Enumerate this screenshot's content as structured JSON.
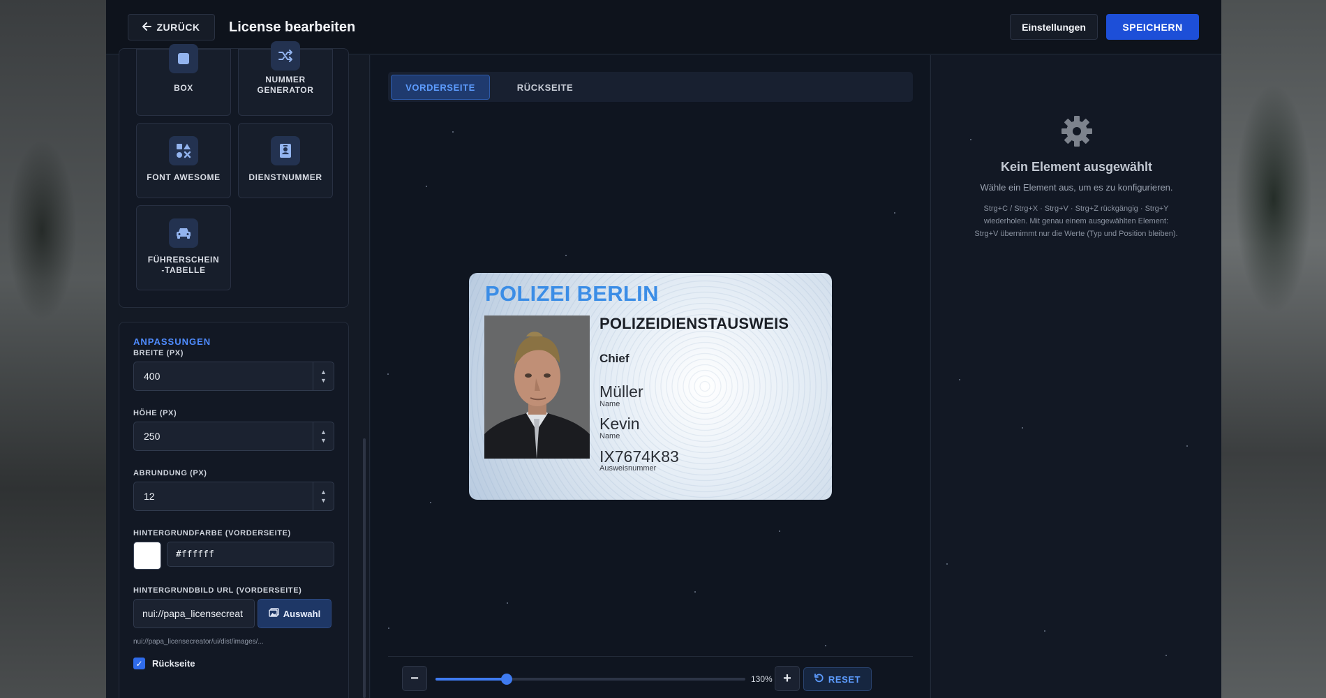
{
  "topbar": {
    "back_label": "ZURÜCK",
    "title": "License bearbeiten",
    "settings_label": "Einstellungen",
    "save_label": "SPEICHERN"
  },
  "elements": [
    {
      "label": "BOX",
      "icon": "square-icon"
    },
    {
      "label": "NUMMER\nGENERATOR",
      "icon": "shuffle-icon"
    },
    {
      "label": "FONT AWESOME",
      "icon": "icons-icon"
    },
    {
      "label": "DIENSTNUMMER",
      "icon": "id-badge-icon"
    },
    {
      "label": "FÜHRERSCHEIN\n-TABELLE",
      "icon": "car-icon"
    }
  ],
  "adjust": {
    "heading": "ANPASSUNGEN",
    "width_label": "BREITE (PX)",
    "width_value": "400",
    "height_label": "HÖHE (PX)",
    "height_value": "250",
    "radius_label": "ABRUNDUNG (PX)",
    "radius_value": "12",
    "bgcolor_label": "HINTERGRUNDFARBE (VORDERSEITE)",
    "bgcolor_value": "#ffffff",
    "bgimage_label": "HINTERGRUNDBILD URL (VORDERSEITE)",
    "bgimage_value": "nui://papa_licensecreat",
    "select_label": "Auswahl",
    "bgimage_hint": "nui://papa_licensecreator/ui/dist/images/...",
    "backside_label": "Rückseite",
    "backside_checked": true
  },
  "tabs": {
    "front": "VORDERSEITE",
    "back": "RÜCKSEITE"
  },
  "card": {
    "title": "POLIZEI BERLIN",
    "heading": "POLIZEIDIENSTAUSWEIS",
    "rank": "Chief",
    "lastname": "Müller",
    "lastname_label": "Name",
    "firstname": "Kevin",
    "firstname_label": "Name",
    "id_number": "IX7674K83",
    "id_label": "Ausweisnummer",
    "title_color": "#3b8de6"
  },
  "zoom": {
    "percent_label": "130%",
    "fraction": 0.23,
    "reset_label": "RESET"
  },
  "inspector": {
    "empty_title": "Kein Element ausgewählt",
    "empty_subtitle": "Wähle ein Element aus, um es zu konfigurieren.",
    "hint": "Strg+C / Strg+X · Strg+V · Strg+Z rückgängig · Strg+Y wiederholen. Mit genau einem ausgewählten Element: Strg+V übernimmt nur die Werte (Typ und Position bleiben)."
  },
  "colors": {
    "accent": "#1d4fd8",
    "tab_active": "#5d9cff"
  }
}
